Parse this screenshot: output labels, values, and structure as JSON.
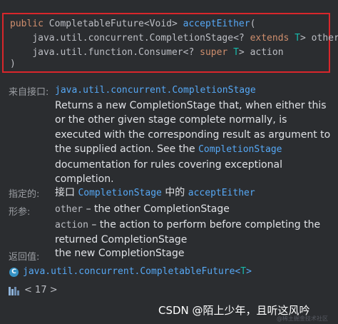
{
  "signature": {
    "line1": {
      "kw_public": "public",
      "ret_type": "CompletableFuture<Void>",
      "method": "acceptEither",
      "open": "("
    },
    "line2": {
      "type": "java.util.concurrent.CompletionStage<?",
      "kw_extends": "extends",
      "tvar": "T",
      "tail": "> other,"
    },
    "line3": {
      "type": "java.util.function.Consumer<?",
      "kw_super": "super",
      "tvar": "T",
      "tail": "> action"
    },
    "line4": {
      "close": ")"
    }
  },
  "from_interface": {
    "label": "来自接口:",
    "link": "java.util.concurrent.CompletionStage",
    "desc_part1": "Returns a new CompletionStage that, when either this or the other given stage complete normally, is executed with the corresponding result as argument to the supplied action. See the ",
    "desc_link": "CompletionStage",
    "desc_part2": " documentation for rules covering exceptional completion."
  },
  "specified_by": {
    "label": "指定的:",
    "prefix": "接口",
    "interface_link": "CompletionStage",
    "middle": "中的",
    "method_link": "acceptEither"
  },
  "params": {
    "label": "形参:",
    "items": [
      {
        "name": "other",
        "desc": " – the other CompletionStage"
      },
      {
        "name": "action",
        "desc": " – the action to perform before completing the returned CompletionStage"
      }
    ]
  },
  "returns": {
    "label": "返回值:",
    "text": "the new CompletionStage"
  },
  "class_ref": {
    "icon_letter": "C",
    "name": "java.util.concurrent.CompletableFuture",
    "generic_open": "<",
    "tvar": "T",
    "generic_close": ">"
  },
  "library": {
    "icon": "library-icon",
    "nav_prev": "<",
    "version": "17",
    "nav_next": ">"
  },
  "watermark": {
    "text": "CSDN @陌上少年，且听这风吟",
    "faint": "@稀土掘金技术社区"
  },
  "colors": {
    "background": "#2b2d30",
    "highlight_border": "#d9262b",
    "keyword": "#cf8e6d",
    "method": "#56a8f5",
    "type_var": "#16baac"
  }
}
